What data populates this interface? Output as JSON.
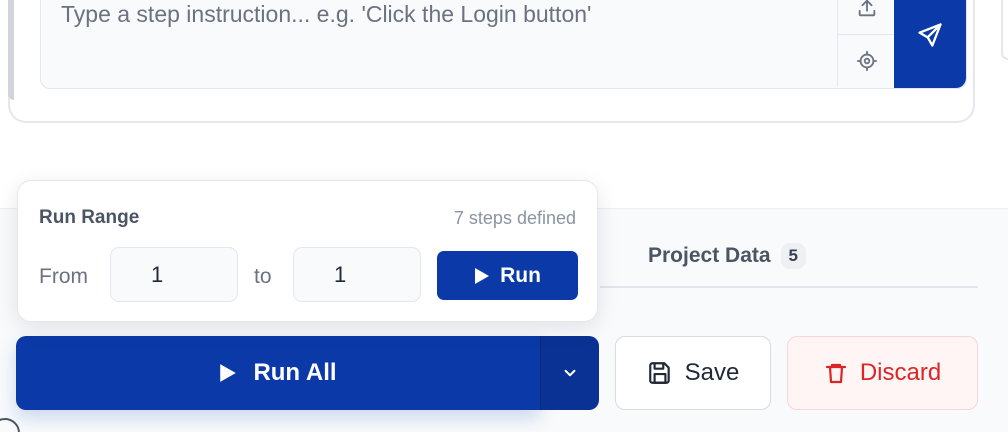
{
  "composer": {
    "placeholder": "Type a step instruction... e.g. 'Click the Login button'",
    "upload_icon": "upload-icon",
    "target_icon": "crosshair-icon",
    "send_icon": "send-icon"
  },
  "tabs": {
    "project_data_label": "Project Data",
    "project_data_count": "5"
  },
  "run_range": {
    "title": "Run Range",
    "steps_defined": "7 steps defined",
    "from_label": "From",
    "from_value": "1",
    "to_label": "to",
    "to_value": "1",
    "run_label": "Run"
  },
  "actions": {
    "run_all_label": "Run All",
    "save_label": "Save",
    "discard_label": "Discard"
  },
  "colors": {
    "primary": "#0b3aa8",
    "danger": "#dc2626",
    "danger_bg": "#fff5f5"
  }
}
